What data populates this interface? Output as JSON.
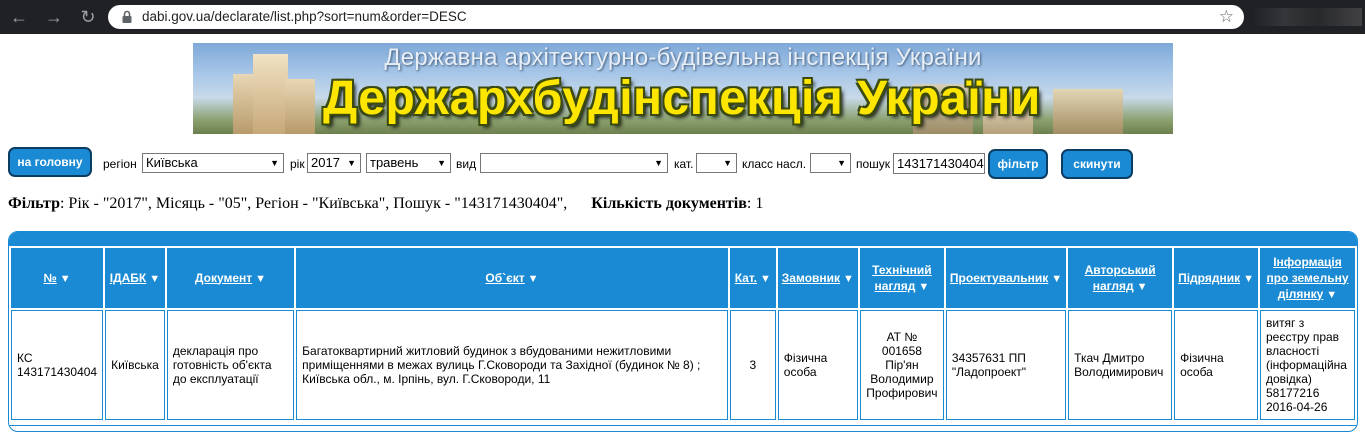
{
  "browser": {
    "url": "dabi.gov.ua/declarate/list.php?sort=num&order=DESC"
  },
  "banner": {
    "title_top": "Державна архітектурно-будівельна інспекція України",
    "title_main": "Держархбудінспекція України"
  },
  "filters": {
    "home_button": "на головну",
    "region_label": "регіон",
    "region_value": "Київська",
    "year_label": "рік",
    "year_value": "2017",
    "month_value": "травень",
    "type_label": "вид",
    "type_value": "",
    "category_label": "кат.",
    "category_value": "",
    "class_label": "класс насл.",
    "class_value": "",
    "search_label": "пошук",
    "search_value": "143171430404",
    "filter_button": "фільтр",
    "reset_button": "скинути"
  },
  "summary": {
    "filter_label": "Фільтр",
    "filter_text": ": Рік - \"2017\", Місяць - \"05\", Регіон - \"Київська\", Пошук - \"143171430404\",",
    "count_label": "Кількість документів",
    "count_text": ": 1"
  },
  "table": {
    "headers": [
      {
        "l1": "№",
        "l2": "",
        "l3": ""
      },
      {
        "l1": "ІДАБК",
        "l2": "",
        "l3": ""
      },
      {
        "l1": "Документ",
        "l2": "",
        "l3": ""
      },
      {
        "l1": "Об`єкт",
        "l2": "",
        "l3": ""
      },
      {
        "l1": "Кат.",
        "l2": "",
        "l3": ""
      },
      {
        "l1": "Замовник",
        "l2": "",
        "l3": ""
      },
      {
        "l1": "Технічний",
        "l2": "нагляд",
        "l3": ""
      },
      {
        "l1": "Проектувальник",
        "l2": "",
        "l3": ""
      },
      {
        "l1": "Авторський",
        "l2": "нагляд",
        "l3": ""
      },
      {
        "l1": "Підрядник",
        "l2": "",
        "l3": ""
      },
      {
        "l1": "Інформація",
        "l2": "про земельну",
        "l3": "ділянку"
      }
    ],
    "row": {
      "num": "КС 143171430404",
      "idabk": "Київська",
      "document": "декларація про готовність об'єкта до експлуатації",
      "object": "Багатоквартирний житловий будинок з вбудованими нежитловими приміщеннями в межах вулиць Г.Сковороди та Західної (будинок № 8) ; Київська обл., м. Ірпінь, вул. Г.Сковороди, 11",
      "category": "3",
      "customer": "Фізична особа",
      "tech_supervision": "АТ № 001658 Пір'ян Володимир Профирович",
      "designer": "34357631 ПП \"Ладопроект\"",
      "author_supervision": "Ткач Дмитро Володимирович",
      "contractor": "Фізична особа",
      "land_info": "витяг з реєстру прав власності (інформаційна довідка) 58177216 2016-04-26"
    }
  }
}
